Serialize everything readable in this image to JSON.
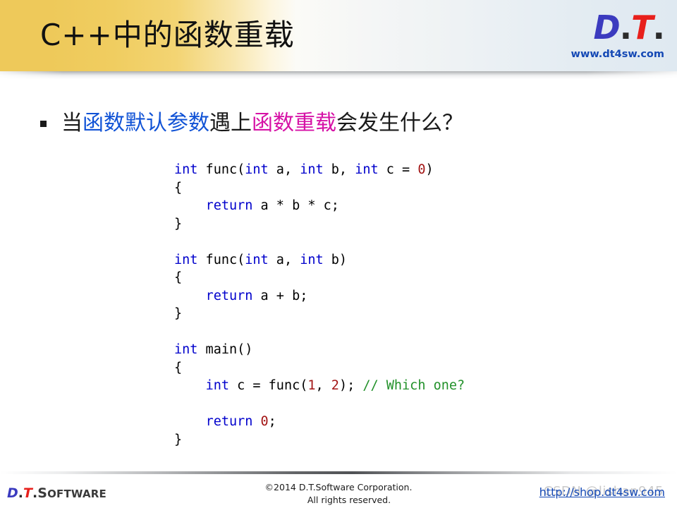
{
  "header": {
    "title": "C++中的函数重载",
    "logo": {
      "d": "D",
      "dot1": ".",
      "t": "T",
      "dot2": ".",
      "url": "www.dt4sw.com"
    }
  },
  "content": {
    "bullet": {
      "marker": "square-bullet",
      "part1": "当",
      "part2_blue": "函数默认参数",
      "part3": "遇上",
      "part4_purple": "函数重载",
      "part5": "会发生什么？"
    },
    "code": {
      "lines": [
        [
          {
            "t": "int",
            "c": "kw"
          },
          {
            "t": " func(",
            "c": "pln"
          },
          {
            "t": "int",
            "c": "kw"
          },
          {
            "t": " a, ",
            "c": "pln"
          },
          {
            "t": "int",
            "c": "kw"
          },
          {
            "t": " b, ",
            "c": "pln"
          },
          {
            "t": "int",
            "c": "kw"
          },
          {
            "t": " c = ",
            "c": "pln"
          },
          {
            "t": "0",
            "c": "num"
          },
          {
            "t": ")",
            "c": "pln"
          }
        ],
        [
          {
            "t": "{",
            "c": "pln"
          }
        ],
        [
          {
            "t": "    ",
            "c": "pln"
          },
          {
            "t": "return",
            "c": "kw"
          },
          {
            "t": " a * b * c;",
            "c": "pln"
          }
        ],
        [
          {
            "t": "}",
            "c": "pln"
          }
        ],
        [
          {
            "t": "",
            "c": "pln"
          }
        ],
        [
          {
            "t": "int",
            "c": "kw"
          },
          {
            "t": " func(",
            "c": "pln"
          },
          {
            "t": "int",
            "c": "kw"
          },
          {
            "t": " a, ",
            "c": "pln"
          },
          {
            "t": "int",
            "c": "kw"
          },
          {
            "t": " b)",
            "c": "pln"
          }
        ],
        [
          {
            "t": "{",
            "c": "pln"
          }
        ],
        [
          {
            "t": "    ",
            "c": "pln"
          },
          {
            "t": "return",
            "c": "kw"
          },
          {
            "t": " a + b;",
            "c": "pln"
          }
        ],
        [
          {
            "t": "}",
            "c": "pln"
          }
        ],
        [
          {
            "t": "",
            "c": "pln"
          }
        ],
        [
          {
            "t": "int",
            "c": "kw"
          },
          {
            "t": " main()",
            "c": "pln"
          }
        ],
        [
          {
            "t": "{",
            "c": "pln"
          }
        ],
        [
          {
            "t": "    ",
            "c": "pln"
          },
          {
            "t": "int",
            "c": "kw"
          },
          {
            "t": " c = func(",
            "c": "pln"
          },
          {
            "t": "1",
            "c": "num"
          },
          {
            "t": ", ",
            "c": "pln"
          },
          {
            "t": "2",
            "c": "num"
          },
          {
            "t": "); ",
            "c": "pln"
          },
          {
            "t": "// Which one?",
            "c": "cmt"
          }
        ],
        [
          {
            "t": "",
            "c": "pln"
          }
        ],
        [
          {
            "t": "    ",
            "c": "pln"
          },
          {
            "t": "return",
            "c": "kw"
          },
          {
            "t": " ",
            "c": "pln"
          },
          {
            "t": "0",
            "c": "num"
          },
          {
            "t": ";",
            "c": "pln"
          }
        ],
        [
          {
            "t": "}",
            "c": "pln"
          }
        ]
      ]
    }
  },
  "footer": {
    "logo": {
      "d": "D",
      "dot1": ".",
      "t": "T",
      "dot2": ".",
      "word_cap": "S",
      "word_rest": "OFTWARE"
    },
    "copyright_line1": "©2014 D.T.Software Corporation.",
    "copyright_line2": "All rights reserved.",
    "link": "http://shop.dt4sw.com",
    "watermark": "CSDN @lishan945"
  },
  "colors": {
    "header_gold": "#eec95a",
    "logo_blue": "#3b3bbf",
    "logo_red": "#e8201c",
    "link_blue": "#1549b5",
    "highlight_blue": "#1153d6",
    "highlight_purple": "#d612a6",
    "code_keyword": "#0000cc",
    "code_number": "#a31515",
    "code_comment": "#22912a"
  }
}
